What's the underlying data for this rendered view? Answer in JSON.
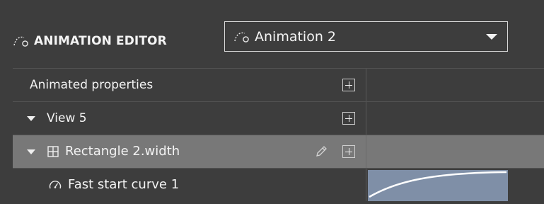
{
  "header": {
    "title": "ANIMATION EDITOR",
    "selected_animation": "Animation 2"
  },
  "rows": {
    "animated_properties": "Animated properties",
    "view": "View 5",
    "property": "Rectangle 2.width",
    "curve": "Fast start curve 1"
  },
  "colors": {
    "background": "#3d3d3d",
    "selected_row": "#787878",
    "curve_fill": "#7f8fa7",
    "text": "#f3f3f3"
  },
  "icons": {
    "title": "animation-curve-icon",
    "add": "plus-icon",
    "edit": "pencil-icon",
    "property": "grid-property-icon",
    "curve": "gauge-icon",
    "dropdown": "chevron-down-icon"
  }
}
